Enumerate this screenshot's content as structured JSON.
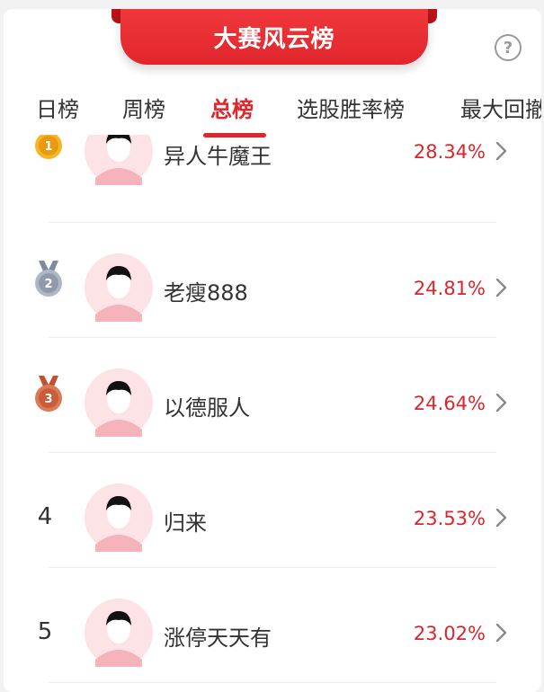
{
  "header": {
    "title": "大赛风云榜",
    "help_glyph": "?"
  },
  "tabs": [
    {
      "label": "日榜"
    },
    {
      "label": "周榜"
    },
    {
      "label": "总榜"
    },
    {
      "label": "选股胜率榜"
    },
    {
      "label": "最大回撤"
    }
  ],
  "active_tab": "总榜",
  "ranking": [
    {
      "rank": "1",
      "name": "异人牛魔王",
      "rate": "28.34%",
      "medal": "gold"
    },
    {
      "rank": "2",
      "name": "老瘦888",
      "rate": "24.81%",
      "medal": "silver"
    },
    {
      "rank": "3",
      "name": "以德服人",
      "rate": "24.64%",
      "medal": "bronze"
    },
    {
      "rank": "4",
      "name": "归来",
      "rate": "23.53%"
    },
    {
      "rank": "5",
      "name": "涨停天天有",
      "rate": "23.02%"
    }
  ],
  "colors": {
    "accent": "#e0262c",
    "rate": "#d8262c",
    "gold": "#f2a51a",
    "silver": "#9aa6b6",
    "bronze": "#d0694a",
    "avatar_bg": "#fde3e6"
  }
}
